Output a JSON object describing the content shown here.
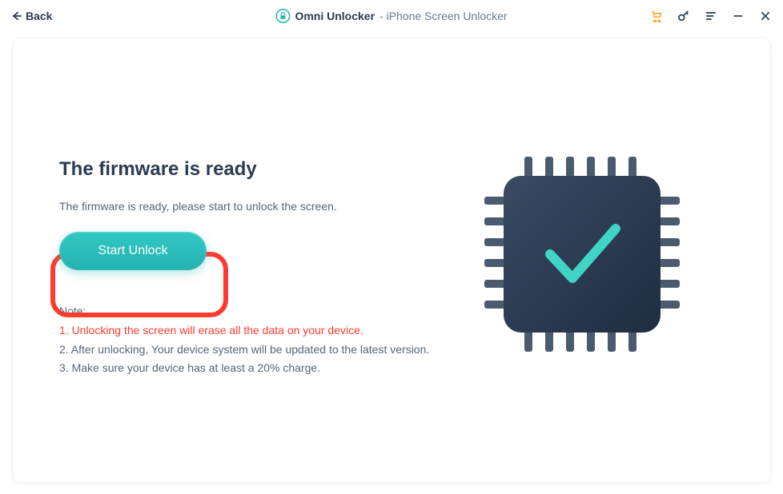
{
  "titlebar": {
    "back_label": "Back",
    "app_name": "Omni Unlocker",
    "app_subtitle": " - iPhone Screen Unlocker"
  },
  "main": {
    "heading": "The firmware is ready",
    "subtitle": "The firmware is ready, please start to unlock the screen.",
    "start_button_label": "Start Unlock",
    "note_label": "Note:",
    "note_1": "1. Unlocking the screen will erase all the data on your device.",
    "note_2": "2. After unlocking, Your device system will be updated to the latest version.",
    "note_3": "3. Make sure your device has at least a 20% charge."
  },
  "colors": {
    "accent": "#25b3b0",
    "warning": "#ff3b30",
    "text_primary": "#2a3b52",
    "text_secondary": "#55657a"
  },
  "icons": {
    "back": "back-arrow-icon",
    "app": "lock-icon",
    "cart": "cart-icon",
    "key": "key-icon",
    "menu": "menu-icon",
    "minimize": "minimize-icon",
    "close": "close-icon",
    "chip": "chip-check-icon"
  }
}
